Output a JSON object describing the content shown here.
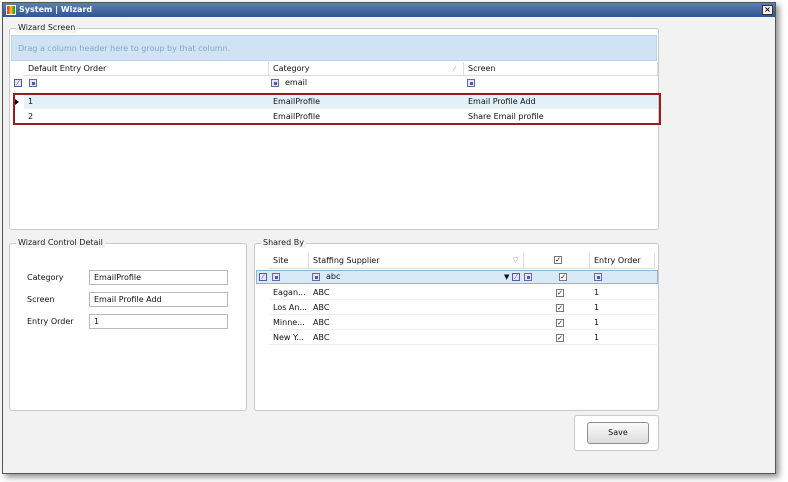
{
  "window": {
    "title": "System | Wizard",
    "close_glyph": "×"
  },
  "wizard_screen": {
    "title": "Wizard Screen",
    "group_panel_text": "Drag a column header here to group by that column.",
    "columns": [
      "Default Entry Order",
      "Category",
      "Screen"
    ],
    "filter": {
      "category": "email"
    },
    "rows": [
      {
        "order": "1",
        "category": "EmailProfile",
        "screen": "Email Profile Add"
      },
      {
        "order": "2",
        "category": "EmailProfile",
        "screen": "Share Email profile"
      }
    ]
  },
  "detail": {
    "title": "Wizard Control Detail",
    "category_label": "Category",
    "category_value": "EmailProfile",
    "screen_label": "Screen",
    "screen_value": "Email Profile Add",
    "entry_order_label": "Entry Order",
    "entry_order_value": "1"
  },
  "shared_by": {
    "title": "Shared By",
    "columns": [
      "Site",
      "Staffing Supplier",
      "Entry Order"
    ],
    "filter": {
      "supplier": "abc"
    },
    "rows": [
      {
        "site": "Eagan...",
        "supplier": "ABC",
        "checked": true,
        "order": "1"
      },
      {
        "site": "Los An...",
        "supplier": "ABC",
        "checked": true,
        "order": "1"
      },
      {
        "site": "Minne...",
        "supplier": "ABC",
        "checked": true,
        "order": "1"
      },
      {
        "site": "New Y...",
        "supplier": "ABC",
        "checked": true,
        "order": "1"
      }
    ]
  },
  "save_label": "Save"
}
